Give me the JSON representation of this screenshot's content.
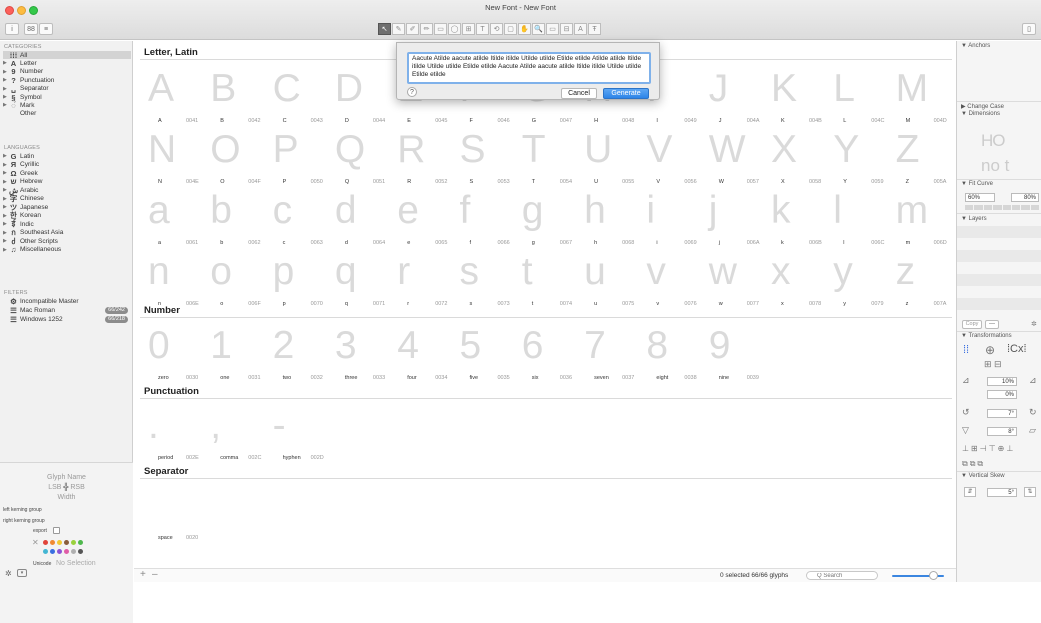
{
  "window": {
    "title": "New Font - New Font"
  },
  "toolbar": {
    "info_label": "i",
    "grid_label": "88",
    "list_label": "≡",
    "tools": [
      "↖",
      "✎",
      "✐",
      "✏",
      "▭",
      "◯",
      "⊞",
      "T",
      "⟲",
      "▢",
      "✋",
      "🔍",
      "▭",
      "⊟",
      "A",
      "Ŧ"
    ],
    "right_label": "▯"
  },
  "sidebar": {
    "categories_header": "CATEGORIES",
    "categories": [
      {
        "sym": "⁞⁞⁞",
        "label": "All",
        "selected": true
      },
      {
        "sym": "A",
        "label": "Letter"
      },
      {
        "sym": "9",
        "label": "Number"
      },
      {
        "sym": "?",
        "label": "Punctuation"
      },
      {
        "sym": "␣",
        "label": "Separator"
      },
      {
        "sym": "§",
        "label": "Symbol"
      },
      {
        "sym": "◌́",
        "label": "Mark"
      },
      {
        "sym": "",
        "label": "Other"
      }
    ],
    "languages_header": "LANGUAGES",
    "languages": [
      {
        "sym": "G",
        "label": "Latin"
      },
      {
        "sym": "Я",
        "label": "Cyrillic"
      },
      {
        "sym": "Ω",
        "label": "Greek"
      },
      {
        "sym": "ש",
        "label": "Hebrew"
      },
      {
        "sym": "ش",
        "label": "Arabic"
      },
      {
        "sym": "字",
        "label": "Chinese"
      },
      {
        "sym": "ツ",
        "label": "Japanese"
      },
      {
        "sym": "한",
        "label": "Korean"
      },
      {
        "sym": "ई",
        "label": "Indic"
      },
      {
        "sym": "ก",
        "label": "Southeast Asia"
      },
      {
        "sym": "ძ",
        "label": "Other Scripts"
      },
      {
        "sym": "♫",
        "label": "Miscellaneous"
      }
    ],
    "filters_header": "FILTERS",
    "filters": [
      {
        "sym": "⚙",
        "label": "Incompatible Master",
        "badge": ""
      },
      {
        "sym": "☰",
        "label": "Mac Roman",
        "badge": "66/242"
      },
      {
        "sym": "☰",
        "label": "Windows 1252",
        "badge": "66/218"
      }
    ]
  },
  "info_panel": {
    "glyph_name": "Glyph Name",
    "lsb": "LSB",
    "rsb": "RSB",
    "width": "Width",
    "left_kerning": "left kerning group",
    "right_kerning": "right kerning group",
    "export": "export",
    "unicode": "Unicode",
    "unicode_value": "No Selection",
    "colors": [
      "#e0453a",
      "#f08a33",
      "#f2c933",
      "#8a5d3b",
      "#9ad13c",
      "#4fb84d",
      "#44b6d3",
      "#3a6fe0",
      "#8d54d6",
      "#e05da8",
      "#b0b0b0",
      "#555555"
    ]
  },
  "sections": {
    "letter": "Letter, Latin",
    "number": "Number",
    "punctuation": "Punctuation",
    "separator": "Separator"
  },
  "uppercase": [
    [
      "A",
      "0041"
    ],
    [
      "B",
      "0042"
    ],
    [
      "C",
      "0043"
    ],
    [
      "D",
      "0044"
    ],
    [
      "E",
      "0045"
    ],
    [
      "F",
      "0046"
    ],
    [
      "G",
      "0047"
    ],
    [
      "H",
      "0048"
    ],
    [
      "I",
      "0049"
    ],
    [
      "J",
      "004A"
    ],
    [
      "K",
      "004B"
    ],
    [
      "L",
      "004C"
    ],
    [
      "M",
      "004D"
    ],
    [
      "N",
      "004E"
    ],
    [
      "O",
      "004F"
    ],
    [
      "P",
      "0050"
    ],
    [
      "Q",
      "0051"
    ],
    [
      "R",
      "0052"
    ],
    [
      "S",
      "0053"
    ],
    [
      "T",
      "0054"
    ],
    [
      "U",
      "0055"
    ],
    [
      "V",
      "0056"
    ],
    [
      "W",
      "0057"
    ],
    [
      "X",
      "0058"
    ],
    [
      "Y",
      "0059"
    ],
    [
      "Z",
      "005A"
    ]
  ],
  "lowercase": [
    [
      "a",
      "0061"
    ],
    [
      "b",
      "0062"
    ],
    [
      "c",
      "0063"
    ],
    [
      "d",
      "0064"
    ],
    [
      "e",
      "0065"
    ],
    [
      "f",
      "0066"
    ],
    [
      "g",
      "0067"
    ],
    [
      "h",
      "0068"
    ],
    [
      "i",
      "0069"
    ],
    [
      "j",
      "006A"
    ],
    [
      "k",
      "006B"
    ],
    [
      "l",
      "006C"
    ],
    [
      "m",
      "006D"
    ],
    [
      "n",
      "006E"
    ],
    [
      "o",
      "006F"
    ],
    [
      "p",
      "0070"
    ],
    [
      "q",
      "0071"
    ],
    [
      "r",
      "0072"
    ],
    [
      "s",
      "0073"
    ],
    [
      "t",
      "0074"
    ],
    [
      "u",
      "0075"
    ],
    [
      "v",
      "0076"
    ],
    [
      "w",
      "0077"
    ],
    [
      "x",
      "0078"
    ],
    [
      "y",
      "0079"
    ],
    [
      "z",
      "007A"
    ]
  ],
  "numbers": [
    [
      "0",
      "zero",
      "0030"
    ],
    [
      "1",
      "one",
      "0031"
    ],
    [
      "2",
      "two",
      "0032"
    ],
    [
      "3",
      "three",
      "0033"
    ],
    [
      "4",
      "four",
      "0034"
    ],
    [
      "5",
      "five",
      "0035"
    ],
    [
      "6",
      "six",
      "0036"
    ],
    [
      "7",
      "seven",
      "0037"
    ],
    [
      "8",
      "eight",
      "0038"
    ],
    [
      "9",
      "nine",
      "0039"
    ]
  ],
  "punctuation": [
    [
      ".",
      "period",
      "002E"
    ],
    [
      ",",
      "comma",
      "002C"
    ],
    [
      "-",
      "hyphen",
      "002D"
    ]
  ],
  "separators": [
    [
      " ",
      "space",
      "0020"
    ]
  ],
  "dialog": {
    "text": "Aacute Atilde aacute atilde Itilde itilde Utilde utilde Etilde etilde Atilde atilde Itilde itilde Utilde utilde Etilde etilde Aacute Atilde aacute atilde Itilde itilde Utilde utilde Etilde etilde",
    "help": "?",
    "cancel": "Cancel",
    "generate": "Generate"
  },
  "status": {
    "add": "+",
    "remove": "–",
    "selected": "0 selected 66/66 glyphs",
    "search_placeholder": "Q Search"
  },
  "right_panel": {
    "anchors": "Anchors",
    "change_case": "Change Case",
    "dimensions": "Dimensions",
    "dim_preview": "HO",
    "dim_preview2": "no t",
    "fit_curve": "Fit Curve",
    "fit_left": "60%",
    "fit_right": "80%",
    "layers": "Layers",
    "copy": "Copy",
    "transformations": "Transformations",
    "scale": "10%",
    "scale2": "0%",
    "rotate": "7°",
    "slant": "8°",
    "vertical_skew": "Vertical Skew",
    "vskew": "5°"
  }
}
